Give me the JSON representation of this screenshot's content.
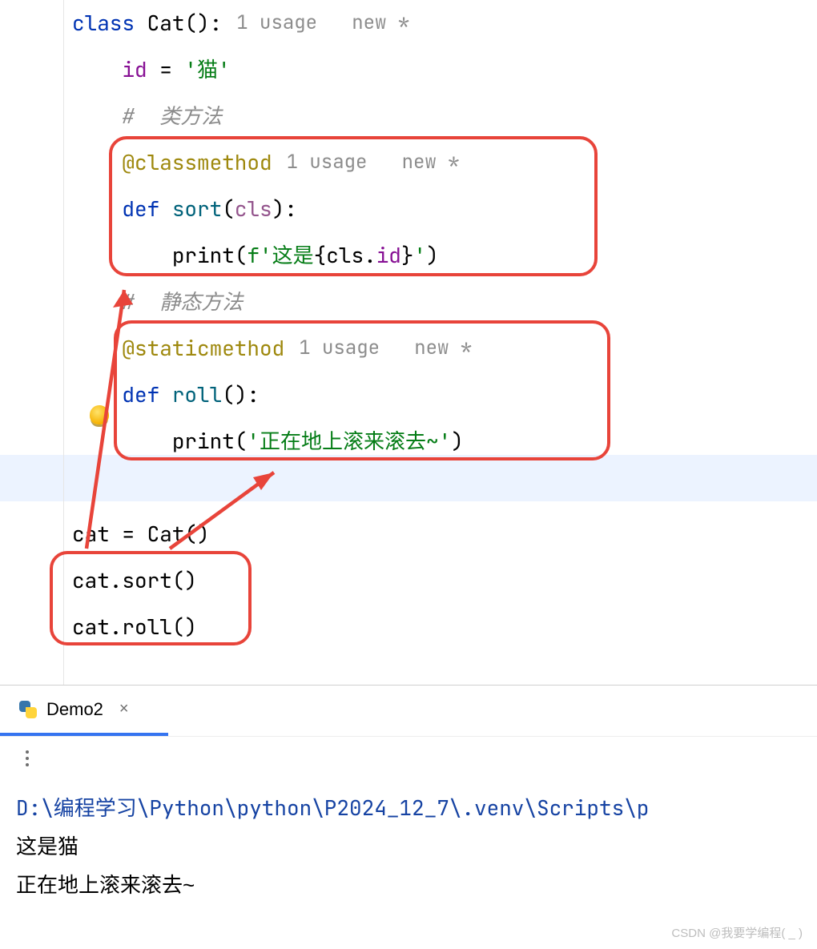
{
  "code": {
    "class_kw": "class",
    "class_name": "Cat",
    "class_suffix": "():",
    "class_inlay": "1 usage   new *",
    "id_field": "id",
    "id_assign": " = ",
    "id_value": "'猫'",
    "cmt1_hash": "# ",
    "cmt1_text": " 类方法",
    "dec1": "@classmethod",
    "dec1_inlay": "1 usage   new *",
    "def_kw": "def",
    "sort_name": "sort",
    "sort_params_open": "(",
    "sort_param": "cls",
    "sort_params_close": "):",
    "print_call": "print",
    "sort_print_arg_open": "(",
    "sort_f": "f",
    "sort_str_open": "'这是",
    "sort_lbrace": "{",
    "sort_cls": "cls",
    "sort_dot": ".",
    "sort_id": "id",
    "sort_rbrace": "}",
    "sort_str_close": "'",
    "sort_print_arg_close": ")",
    "cmt2_hash": "# ",
    "cmt2_text": " 静态方法",
    "dec2": "@staticmethod",
    "dec2_inlay": "1 usage   new *",
    "roll_name": "roll",
    "roll_params": "():",
    "roll_print_arg": "'正在地上滚来滚去~'",
    "line_cat_assign": "cat = Cat()",
    "line_cat_sort": "cat.sort()",
    "line_cat_roll": "cat.roll()"
  },
  "tab": {
    "name": "Demo2",
    "close": "×"
  },
  "console": {
    "cmd": "D:\\编程学习\\Python\\python\\P2024_12_7\\.venv\\Scripts\\p",
    "out1": "这是猫",
    "out2": "正在地上滚来滚去~"
  },
  "watermark": "CSDN @我要学编程(  _  )"
}
